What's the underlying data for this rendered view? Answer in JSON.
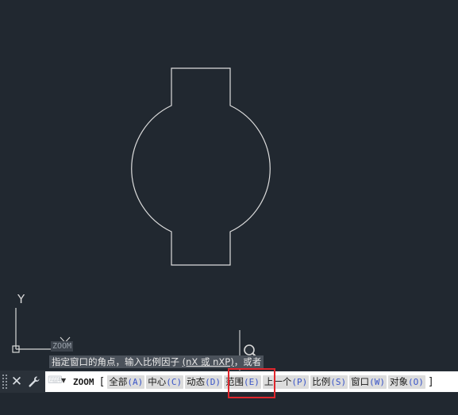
{
  "canvas": {
    "background_color": "#212830",
    "line_color": "#dcdcdc",
    "ucs_y_label": "Y"
  },
  "cursor": {
    "zoom_tag": "ZOOM"
  },
  "tooltip": {
    "prefix": "指定窗口的角点，输入比例因子 ",
    "option": "(nX 或 nXP)",
    "suffix": "，或者"
  },
  "command_bar": {
    "close_icon": "✕",
    "customize_icon": "🔧",
    "recent_icon": "⌨",
    "dropdown_icon": "▼",
    "command_name": "ZOOM",
    "open_bracket": "[",
    "close_bracket": "]",
    "options": [
      {
        "label": "全部",
        "key": "(A)"
      },
      {
        "label": "中心",
        "key": "(C)"
      },
      {
        "label": "动态",
        "key": "(D)"
      },
      {
        "label": "范围",
        "key": "(E)"
      },
      {
        "label": "上一个",
        "key": "(P)"
      },
      {
        "label": "比例",
        "key": "(S)"
      },
      {
        "label": "窗口",
        "key": "(W)"
      },
      {
        "label": "对象",
        "key": "(O)"
      }
    ],
    "highlight_color": "#e0262c"
  }
}
